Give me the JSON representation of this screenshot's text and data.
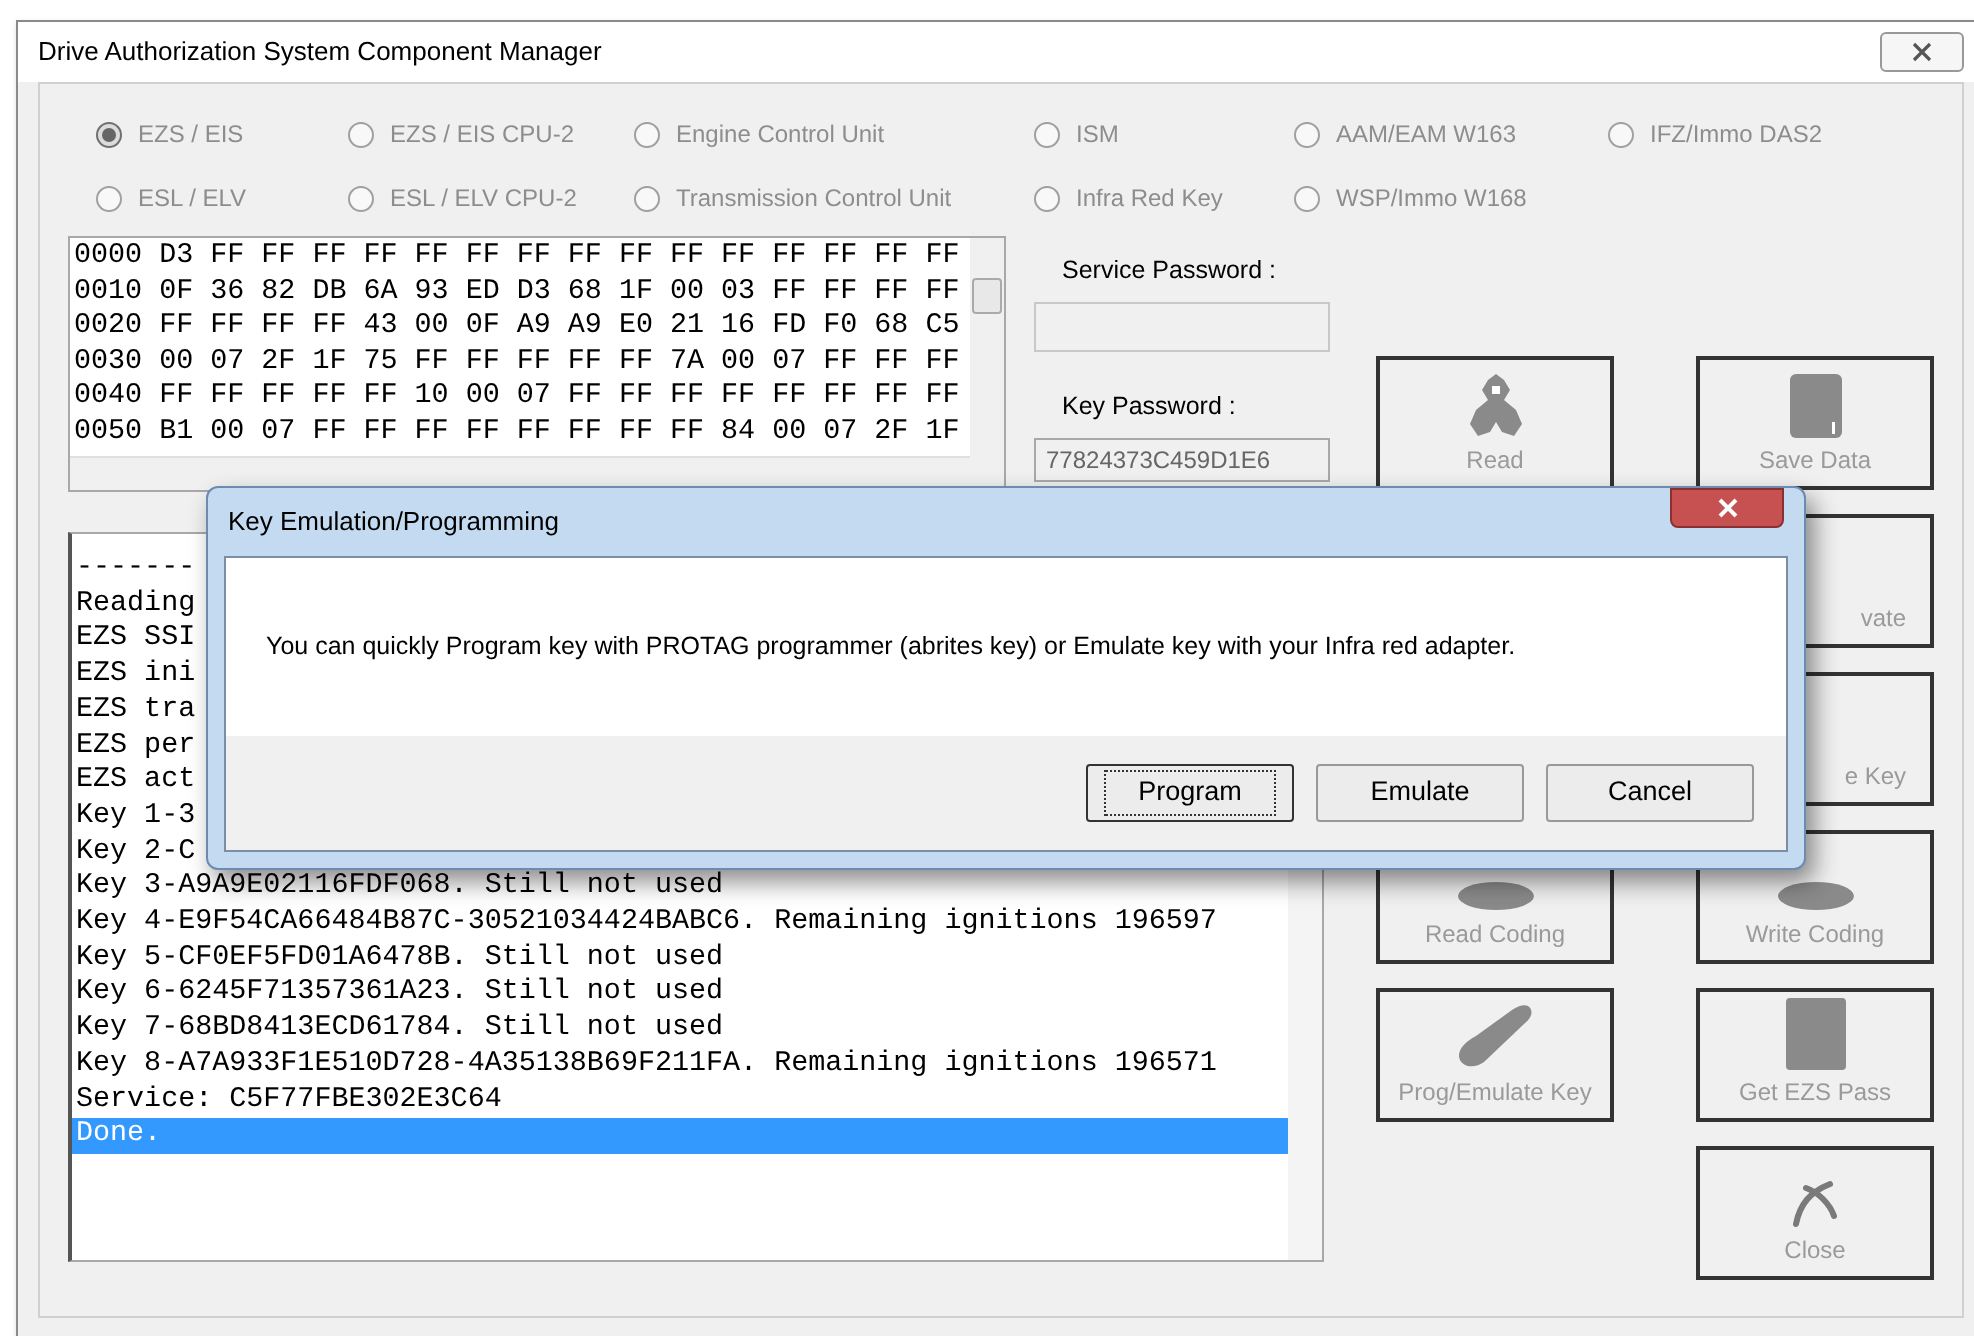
{
  "window": {
    "title": "Drive Authorization System Component Manager"
  },
  "radios": [
    [
      {
        "label": "EZS / EIS",
        "selected": true,
        "disabled": true
      },
      {
        "label": "EZS / EIS CPU-2",
        "selected": false,
        "disabled": true
      },
      {
        "label": "Engine Control Unit",
        "selected": false,
        "disabled": true
      },
      {
        "label": "ISM",
        "selected": false,
        "disabled": true
      },
      {
        "label": "AAM/EAM W163",
        "selected": false,
        "disabled": true
      },
      {
        "label": "IFZ/Immo DAS2",
        "selected": false,
        "disabled": true
      }
    ],
    [
      {
        "label": "ESL / ELV",
        "selected": false,
        "disabled": true
      },
      {
        "label": "ESL / ELV CPU-2",
        "selected": false,
        "disabled": true
      },
      {
        "label": "Transmission Control Unit",
        "selected": false,
        "disabled": true
      },
      {
        "label": "Infra Red Key",
        "selected": false,
        "disabled": true
      },
      {
        "label": "WSP/Immo W168",
        "selected": false,
        "disabled": true
      }
    ]
  ],
  "hex_lines": [
    "0000 D3 FF FF FF FF FF FF FF FF FF FF FF FF FF FF FF",
    "0010 0F 36 82 DB 6A 93 ED D3 68 1F 00 03 FF FF FF FF",
    "0020 FF FF FF FF 43 00 0F A9 A9 E0 21 16 FD F0 68 C5",
    "0030 00 07 2F 1F 75 FF FF FF FF FF 7A 00 07 FF FF FF",
    "0040 FF FF FF FF FF 10 00 07 FF FF FF FF FF FF FF FF",
    "0050 B1 00 07 FF FF FF FF FF FF FF FF 84 00 07 2F 1F"
  ],
  "service_password": {
    "label": "Service Password :"
  },
  "key_password": {
    "label": "Key Password :",
    "value": "77824373C459D1E6"
  },
  "log_lines": [
    {
      "text": "-------",
      "selected": false
    },
    {
      "text": "Reading",
      "selected": false
    },
    {
      "text": "EZS SSI",
      "selected": false
    },
    {
      "text": "EZS ini",
      "selected": false
    },
    {
      "text": "EZS tra",
      "selected": false
    },
    {
      "text": "EZS per",
      "selected": false
    },
    {
      "text": "EZS act",
      "selected": false
    },
    {
      "text": "Key 1-3",
      "selected": false
    },
    {
      "text": "Key 2-C",
      "selected": false
    },
    {
      "text": "Key 3-A9A9E02116FDF068. Still not used",
      "selected": false
    },
    {
      "text": "Key 4-E9F54CA66484B87C-30521034424BABC6. Remaining ignitions 196597",
      "selected": false
    },
    {
      "text": "Key 5-CF0EF5FD01A6478B. Still not used",
      "selected": false
    },
    {
      "text": "Key 6-6245F71357361A23. Still not used",
      "selected": false
    },
    {
      "text": "Key 7-68BD8413ECD61784. Still not used",
      "selected": false
    },
    {
      "text": "Key 8-A7A933F1E510D728-4A35138B69F211FA. Remaining ignitions 196571",
      "selected": false
    },
    {
      "text": "Service: C5F77FBE302E3C64",
      "selected": false
    },
    {
      "text": "Done.",
      "selected": true
    }
  ],
  "action_buttons": [
    [
      {
        "label": "Read",
        "kind": "read",
        "disabled": true
      },
      {
        "label": "Save Data",
        "kind": "save",
        "disabled": true
      }
    ],
    [
      {
        "kind": "hidden"
      },
      {
        "label": "vate",
        "kind": "partial",
        "disabled": true
      }
    ],
    [
      {
        "kind": "hidden"
      },
      {
        "label": "e Key",
        "kind": "partial",
        "disabled": true
      }
    ],
    [
      {
        "label": "Read Coding",
        "kind": "coding",
        "disabled": true
      },
      {
        "label": "Write Coding",
        "kind": "coding",
        "disabled": true
      }
    ],
    [
      {
        "label": "Prog/Emulate Key",
        "kind": "fob",
        "disabled": true
      },
      {
        "label": "Get EZS Pass",
        "kind": "card",
        "disabled": true
      }
    ],
    [
      {
        "kind": "empty"
      },
      {
        "label": "Close",
        "kind": "close",
        "disabled": true
      }
    ]
  ],
  "dialog": {
    "title": "Key Emulation/Programming",
    "message": "You can quickly Program key with PROTAG programmer (abrites key) or Emulate key with your Infra red adapter.",
    "buttons": [
      {
        "label": "Program",
        "focused": true
      },
      {
        "label": "Emulate",
        "focused": false
      },
      {
        "label": "Cancel",
        "focused": false
      }
    ]
  }
}
